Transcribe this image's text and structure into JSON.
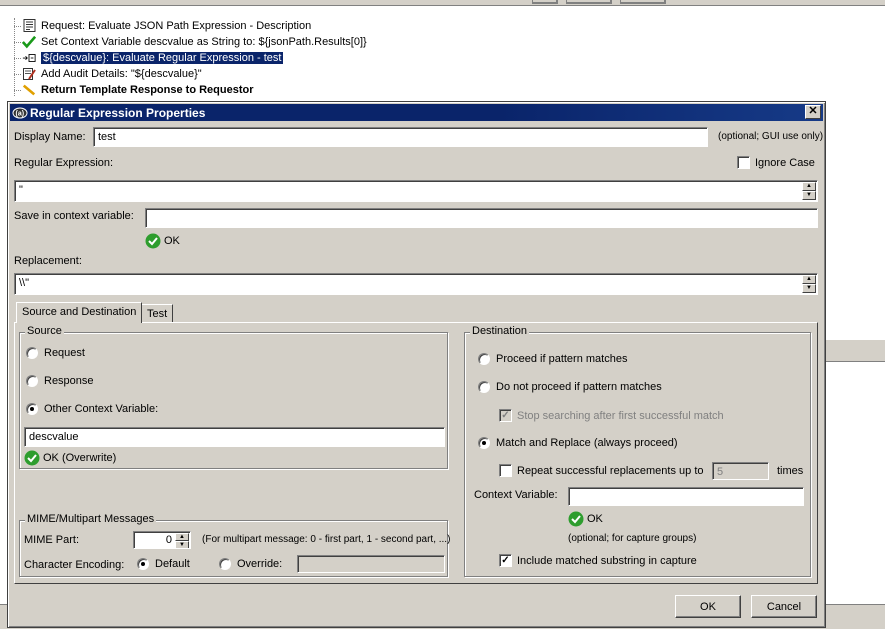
{
  "tree": {
    "items": [
      {
        "icon": "document-icon",
        "label": "Request: Evaluate JSON Path Expression - Description"
      },
      {
        "icon": "green-check-icon",
        "label": "Set Context Variable descvalue as String to: ${jsonPath.Results[0]}"
      },
      {
        "icon": "regex-icon",
        "label": "${descvalue}: Evaluate Regular Expression - test"
      },
      {
        "icon": "audit-icon",
        "label": "Add Audit Details: \"${descvalue}\""
      },
      {
        "icon": "template-icon",
        "label": "Return Template Response to Requestor"
      }
    ]
  },
  "dialog": {
    "title": "Regular Expression Properties",
    "close_glyph": "✕",
    "display_name": {
      "label": "Display Name:",
      "value": "test",
      "hint": "(optional; GUI use only)"
    },
    "regex": {
      "label": "Regular Expression:",
      "value": "\"",
      "ignore_case_label": "Ignore Case",
      "ignore_case": false
    },
    "save_context": {
      "label": "Save in context variable:",
      "value": "",
      "status": "OK"
    },
    "replacement": {
      "label": "Replacement:",
      "value": "\\\\\""
    },
    "tabs": [
      {
        "label": "Source and Destination",
        "active": true
      },
      {
        "label": "Test",
        "active": false
      }
    ],
    "source": {
      "title": "Source",
      "options": [
        "Request",
        "Response",
        "Other Context Variable:"
      ],
      "selected": 2,
      "variable": "descvalue",
      "status": "OK (Overwrite)"
    },
    "mime": {
      "title": "MIME/Multipart Messages",
      "part_label": "MIME Part:",
      "part_value": "0",
      "part_hint": "(For multipart message: 0 - first part, 1 - second part, ...)",
      "encoding_label": "Character Encoding:",
      "default_label": "Default",
      "override_label": "Override:",
      "selected": "default",
      "override_value": ""
    },
    "destination": {
      "title": "Destination",
      "proceed_label": "Proceed if pattern matches",
      "not_proceed_label": "Do not proceed if pattern matches",
      "stop_label": "Stop searching after first successful match",
      "stop_checked": true,
      "replace_label": "Match and Replace (always proceed)",
      "selected": "replace",
      "repeat_label": "Repeat successful replacements up to",
      "repeat_checked": false,
      "repeat_value": "5",
      "times_label": "times",
      "context_label": "Context Variable:",
      "context_value": "",
      "context_status": "OK",
      "context_hint": "(optional; for capture groups)",
      "include_label": "Include matched substring in capture",
      "include_checked": true
    },
    "buttons": {
      "ok": "OK",
      "cancel": "Cancel"
    }
  }
}
